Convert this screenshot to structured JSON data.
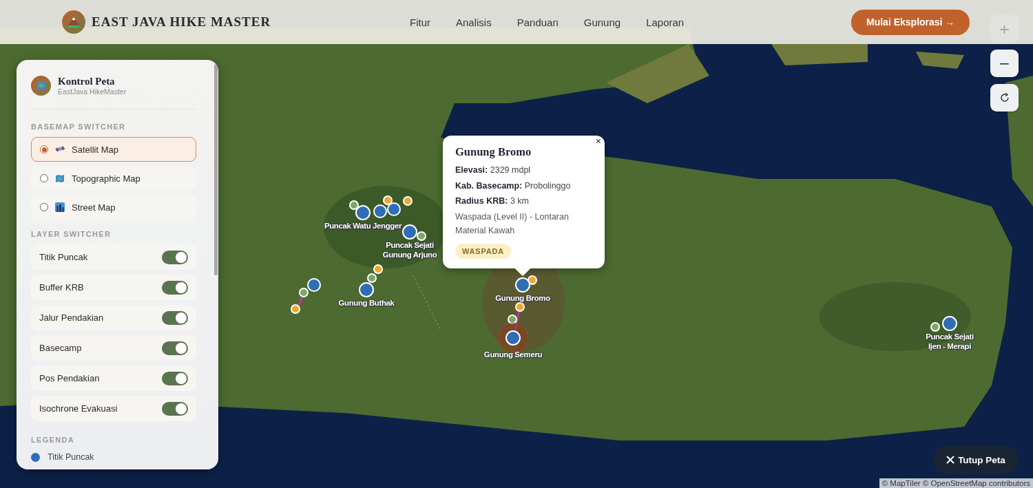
{
  "header": {
    "brand": "EAST JAVA HIKE MASTER",
    "nav": [
      {
        "label": "Fitur"
      },
      {
        "label": "Analisis"
      },
      {
        "label": "Panduan"
      },
      {
        "label": "Gunung"
      },
      {
        "label": "Laporan"
      }
    ],
    "cta": "Mulai Eksplorasi →"
  },
  "map_controls": [
    {
      "kind": "zoom_in",
      "label": "+",
      "disabled": true
    },
    {
      "kind": "zoom_out",
      "label": "−",
      "disabled": false
    },
    {
      "kind": "reset",
      "disabled": false
    }
  ],
  "panel": {
    "title": "Kontrol Peta",
    "subtitle": "EastJava HikeMaster",
    "basemap_heading": "BASEMAP SWITCHER",
    "basemaps": [
      {
        "kind": "satellite",
        "label": "Satellit Map",
        "selected": true
      },
      {
        "kind": "topographic",
        "label": "Topographic Map",
        "selected": false
      },
      {
        "kind": "street",
        "label": "Street Map",
        "selected": false
      }
    ],
    "layer_heading": "LAYER SWITCHER",
    "layers": [
      {
        "label": "Titik Puncak",
        "on": true
      },
      {
        "label": "Buffer KRB",
        "on": true
      },
      {
        "label": "Jalur Pendakian",
        "on": true
      },
      {
        "label": "Basecamp",
        "on": true
      },
      {
        "label": "Pos Pendakian",
        "on": true
      },
      {
        "label": "Isochrone Evakuasi",
        "on": true
      }
    ],
    "legend_heading": "LEGENDA",
    "legend": [
      {
        "label": "Titik Puncak",
        "color": "#2f6db5"
      }
    ]
  },
  "markers": [
    {
      "label": "Puncak Watu Jengger",
      "buffer": false
    },
    {
      "label": "Puncak Sejati Gunung Arjuno",
      "buffer": false
    },
    {
      "label": "Gunung Buthak",
      "buffer": false
    },
    {
      "label": "Gunung Bromo",
      "buffer": false
    },
    {
      "label": "Gunung Semeru",
      "buffer": true
    },
    {
      "label": "Puncak Sejati Ijen - Merapi",
      "buffer": false
    }
  ],
  "popup": {
    "title": "Gunung Bromo",
    "close": "×",
    "fields": [
      {
        "label": "Elevasi:",
        "value": "2329 mdpl"
      },
      {
        "label": "Kab. Basecamp:",
        "value": "Probolinggo"
      },
      {
        "label": "Radius KRB:",
        "value": "3 km"
      }
    ],
    "description": "Waspada (Level II) - Lontaran Material Kawah",
    "badge": "WASPADA"
  },
  "close_map": "Tutup Peta",
  "attribution": "© MapTiler © OpenStreetMap contributors"
}
